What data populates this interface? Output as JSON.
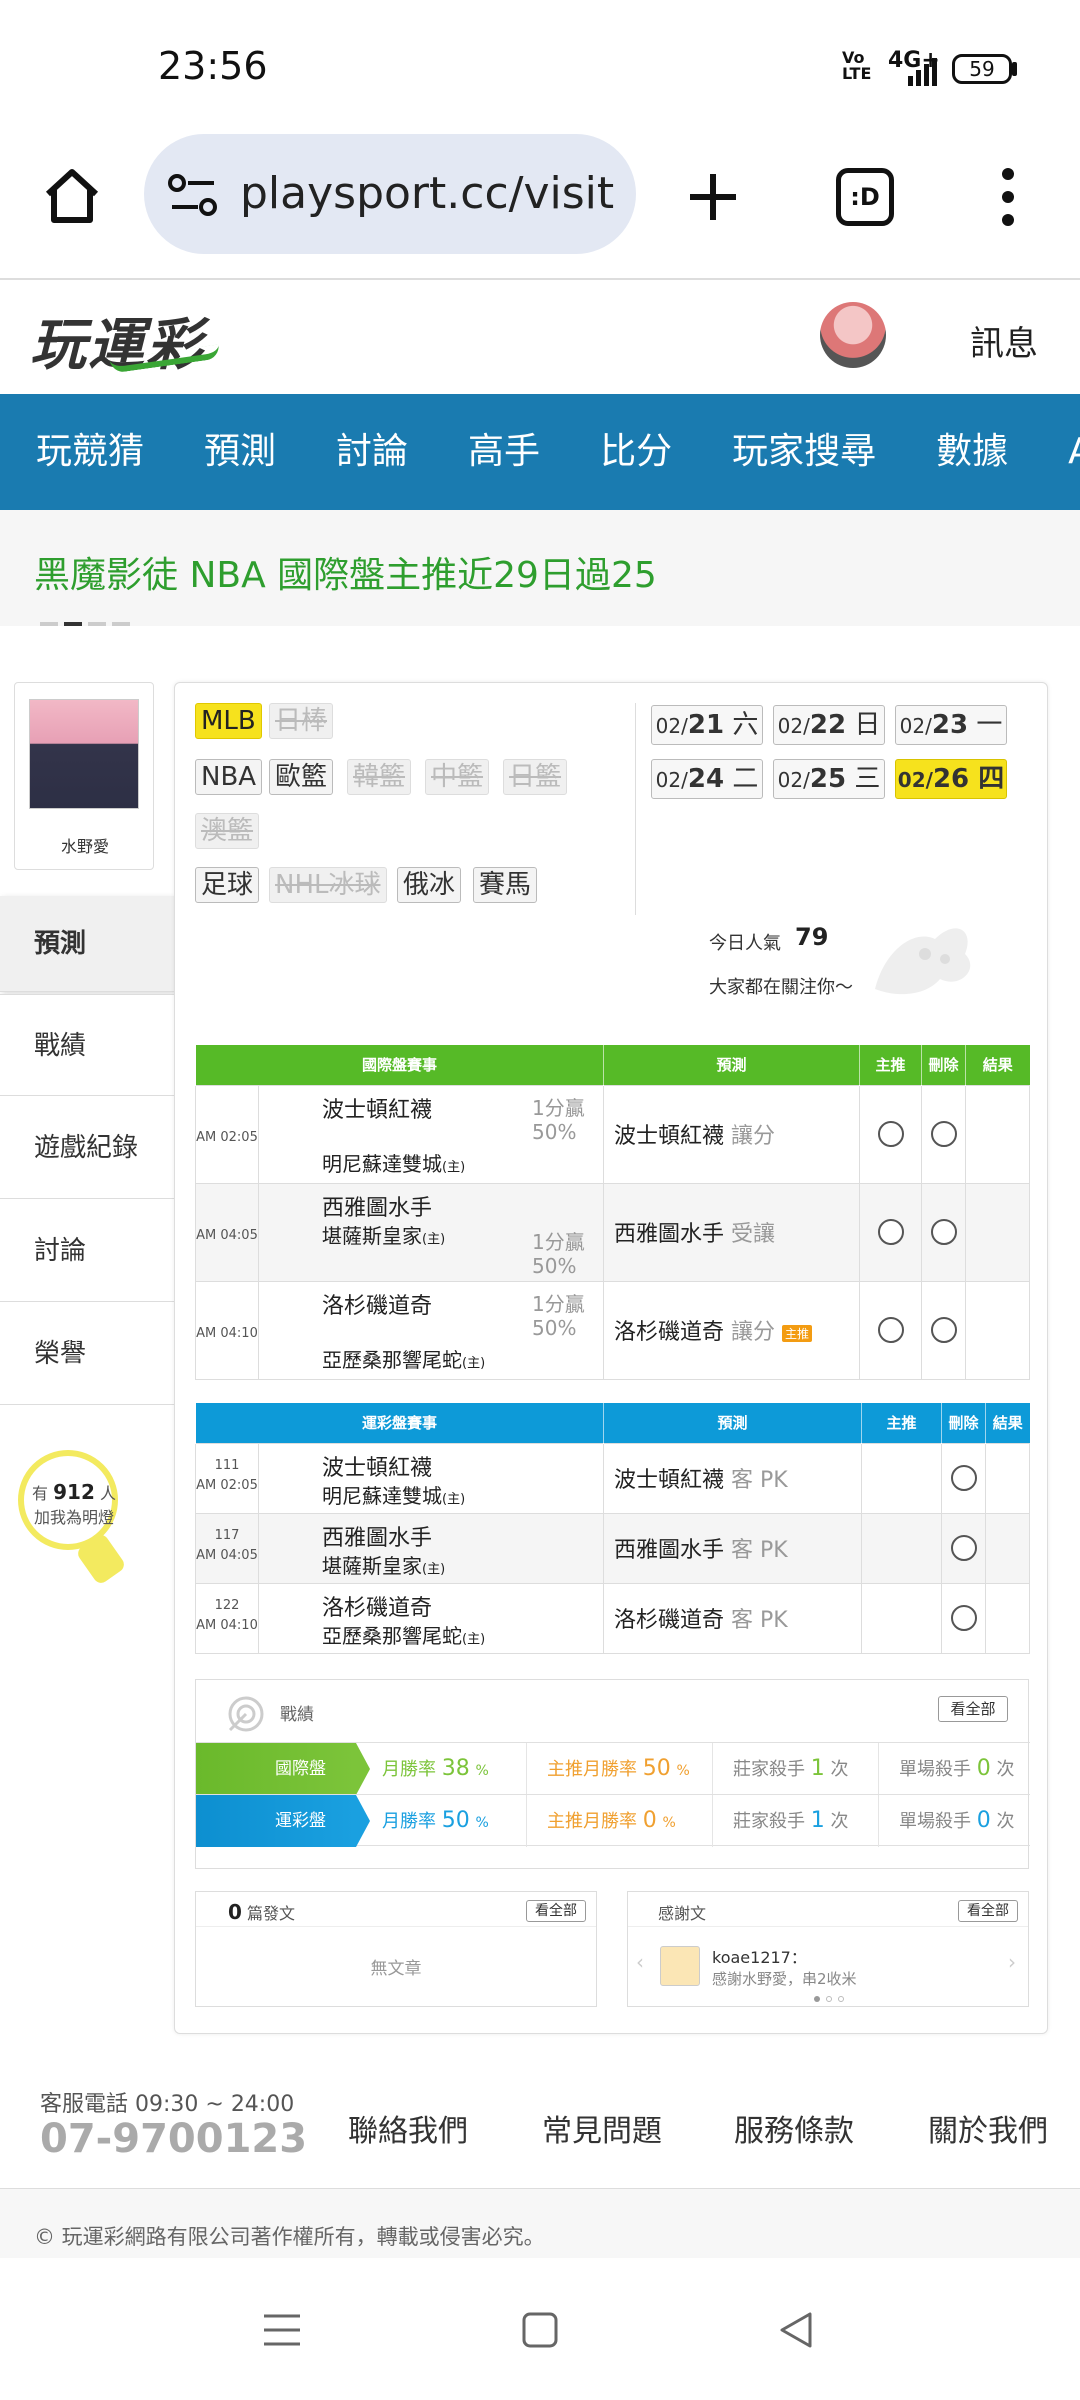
{
  "status_bar": {
    "time": "23:56",
    "volte": "Vo LTE",
    "network": "4G+",
    "battery": "59"
  },
  "browser": {
    "url": "playsport.cc/visit",
    "tab_count_label": ":D"
  },
  "site": {
    "logo": "玩運彩",
    "messages": "訊息"
  },
  "nav": [
    "玩競猜",
    "預測",
    "討論",
    "高手",
    "比分",
    "玩家搜尋",
    "數據",
    "APP"
  ],
  "banner": {
    "text": "黑魔影徒 NBA 國際盤主推近29日過25"
  },
  "profile": {
    "name": "水野愛"
  },
  "side_menu": [
    "預測",
    "戰績",
    "遊戲紀錄",
    "討論",
    "榮譽"
  ],
  "popularity_bulb": {
    "prefix": "有",
    "count": "912",
    "suffix": "人",
    "line2": "加我為明燈"
  },
  "leagues": {
    "row1": [
      {
        "label": "MLB",
        "state": "selected"
      },
      {
        "label": "日棒",
        "state": "disabled"
      }
    ],
    "row2": [
      {
        "label": "NBA",
        "state": "normal"
      },
      {
        "label": "歐籃",
        "state": "normal"
      },
      {
        "label": "韓籃",
        "state": "disabled"
      },
      {
        "label": "中籃",
        "state": "disabled"
      },
      {
        "label": "日籃",
        "state": "disabled"
      }
    ],
    "row3": [
      {
        "label": "澳籃",
        "state": "disabled"
      }
    ],
    "row4": [
      {
        "label": "足球",
        "state": "normal"
      },
      {
        "label": "NHL冰球",
        "state": "disabled"
      },
      {
        "label": "俄冰",
        "state": "normal"
      },
      {
        "label": "賽馬",
        "state": "normal"
      }
    ]
  },
  "dates": [
    {
      "month": "02/",
      "day": "21",
      "weekday": "六"
    },
    {
      "month": "02/",
      "day": "22",
      "weekday": "日"
    },
    {
      "month": "02/",
      "day": "23",
      "weekday": "一"
    },
    {
      "month": "02/",
      "day": "24",
      "weekday": "二"
    },
    {
      "month": "02/",
      "day": "25",
      "weekday": "三"
    },
    {
      "month": "02/",
      "day": "26",
      "weekday": "四",
      "selected": true
    }
  ],
  "popularity": {
    "label": "今日人氣",
    "value": "79",
    "sub": "大家都在關注你～"
  },
  "intl_table": {
    "headers": [
      "國際盤賽事",
      "預測",
      "主推",
      "刪除",
      "結果"
    ],
    "rows": [
      {
        "time": "AM 02:05",
        "away": "波士頓紅襪",
        "home": "明尼蘇達雙城",
        "home_tag": "(主)",
        "odds1": "1分贏",
        "odds2": "50%",
        "pick": "波士頓紅襪",
        "pick_type": "讓分",
        "badge": ""
      },
      {
        "time": "AM 04:05",
        "away": "西雅圖水手",
        "home": "堪薩斯皇家",
        "home_tag": "(主)",
        "odds1": "1分贏",
        "odds2": "50%",
        "pick": "西雅圖水手",
        "pick_type": "受讓",
        "badge": ""
      },
      {
        "time": "AM 04:10",
        "away": "洛杉磯道奇",
        "home": "亞歷桑那響尾蛇",
        "home_tag": "(主)",
        "odds1": "1分贏",
        "odds2": "50%",
        "pick": "洛杉磯道奇",
        "pick_type": "讓分",
        "badge": "主推"
      }
    ]
  },
  "local_table": {
    "headers": [
      "運彩盤賽事",
      "預測",
      "主推",
      "刪除",
      "結果"
    ],
    "rows": [
      {
        "no": "111",
        "time": "AM 02:05",
        "away": "波士頓紅襪",
        "home": "明尼蘇達雙城",
        "home_tag": "(主)",
        "pick": "波士頓紅襪",
        "pick_type": "客 PK"
      },
      {
        "no": "117",
        "time": "AM 04:05",
        "away": "西雅圖水手",
        "home": "堪薩斯皇家",
        "home_tag": "(主)",
        "pick": "西雅圖水手",
        "pick_type": "客 PK"
      },
      {
        "no": "122",
        "time": "AM 04:10",
        "away": "洛杉磯道奇",
        "home": "亞歷桑那響尾蛇",
        "home_tag": "(主)",
        "pick": "洛杉磯道奇",
        "pick_type": "客 PK"
      }
    ]
  },
  "record": {
    "title": "戰績",
    "view_all": "看全部",
    "rows": [
      {
        "label": "國際盤",
        "color": "#7cc43a",
        "month_rate_label": "月勝率",
        "month_rate": "38",
        "main_rate_label": "主推月勝率",
        "main_rate": "50",
        "pct": "%",
        "killer_label": "莊家殺手",
        "killer": "1",
        "single_label": "單場殺手",
        "single": "0",
        "unit": "次"
      },
      {
        "label": "運彩盤",
        "color": "#1aa0e0",
        "month_rate_label": "月勝率",
        "month_rate": "50",
        "main_rate_label": "主推月勝率",
        "main_rate": "0",
        "pct": "%",
        "killer_label": "莊家殺手",
        "killer": "1",
        "single_label": "單場殺手",
        "single": "0",
        "unit": "次"
      }
    ]
  },
  "posts": {
    "count": "0",
    "label": "篇發文",
    "view_all": "看全部",
    "empty": "無文章"
  },
  "thanks": {
    "title": "感謝文",
    "view_all": "看全部",
    "user": "koae1217：",
    "message": "感謝水野愛，串2收米"
  },
  "footer": {
    "tel_label": "客服電話 09:30 ~ 24:00",
    "tel": "07-9700123",
    "links": [
      "聯絡我們",
      "常見問題",
      "服務條款",
      "關於我們"
    ],
    "copyright": "© 玩運彩網路有限公司著作權所有，轉載或侵害必究。"
  }
}
